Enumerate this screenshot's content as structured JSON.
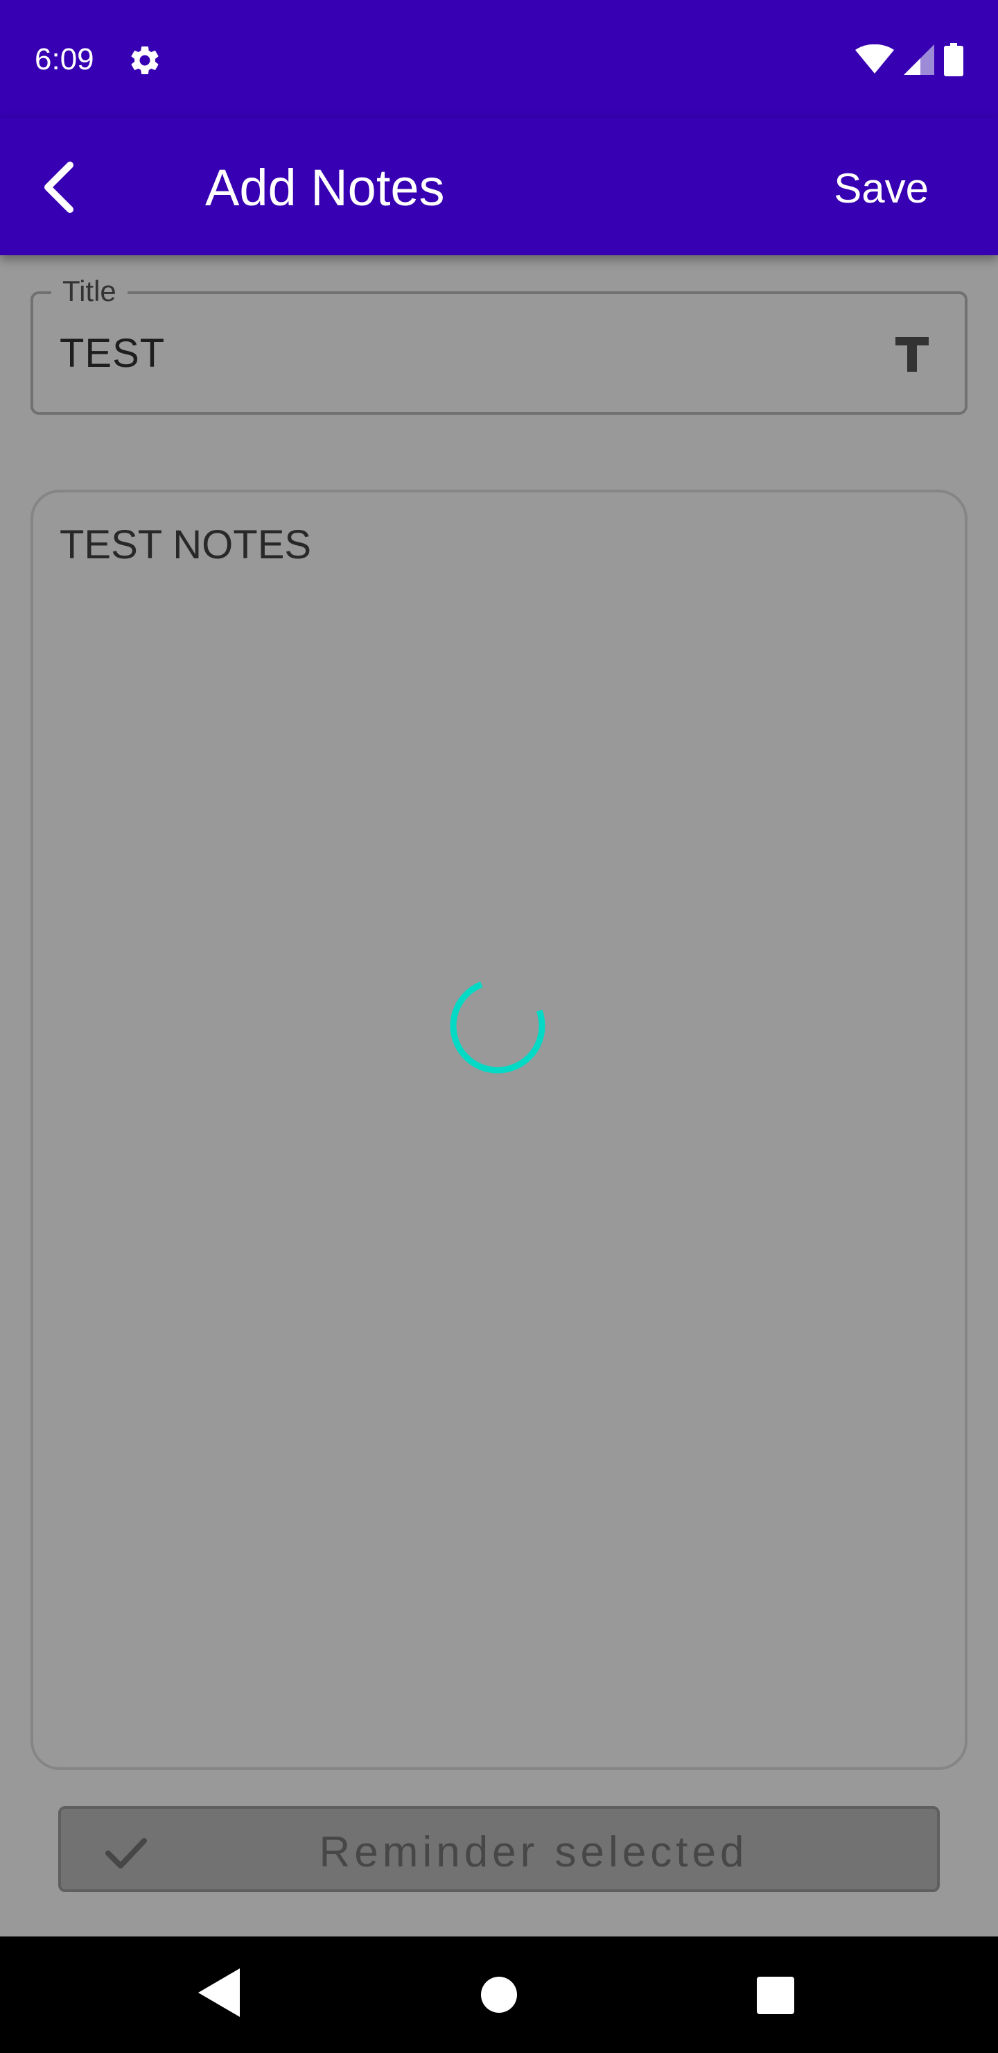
{
  "status_bar": {
    "time": "6:09"
  },
  "app_bar": {
    "title": "Add Notes",
    "save_label": "Save"
  },
  "title_field": {
    "label": "Title",
    "value": "TEST"
  },
  "notes_field": {
    "value": "TEST NOTES"
  },
  "reminder": {
    "label": "Reminder selected"
  },
  "icons": {
    "settings": "gear-icon",
    "wifi": "wifi-icon",
    "signal": "signal-icon",
    "battery": "battery-icon",
    "back": "arrow-back-icon",
    "title_type": "text-format-icon",
    "check": "check-icon",
    "spinner": "loading-spinner",
    "nav_back": "triangle-back-icon",
    "nav_home": "circle-home-icon",
    "nav_recents": "square-recents-icon"
  },
  "colors": {
    "primary": "#3700b3",
    "spinner": "#03dac5",
    "scrim": "rgba(0,0,0,0.40)"
  }
}
